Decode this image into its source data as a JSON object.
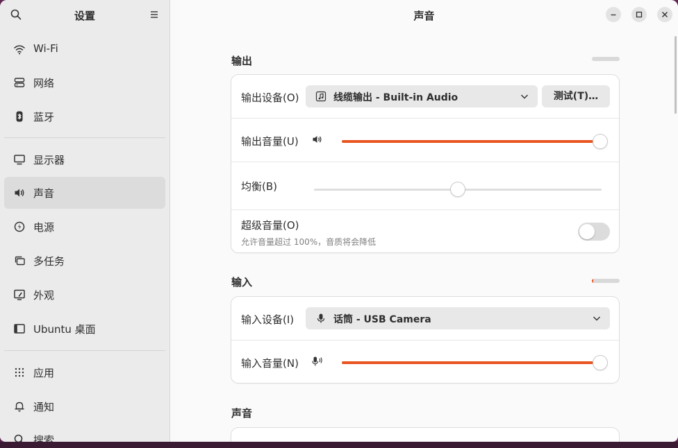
{
  "sidebar": {
    "title": "设置",
    "items": [
      {
        "label": "Wi-Fi",
        "icon": "wifi-icon"
      },
      {
        "label": "网络",
        "icon": "network-icon"
      },
      {
        "label": "蓝牙",
        "icon": "bluetooth-icon"
      },
      {
        "label": "显示器",
        "icon": "display-icon"
      },
      {
        "label": "声音",
        "icon": "speaker-icon"
      },
      {
        "label": "电源",
        "icon": "power-icon"
      },
      {
        "label": "多任务",
        "icon": "multitasking-icon"
      },
      {
        "label": "外观",
        "icon": "appearance-icon"
      },
      {
        "label": "Ubuntu 桌面",
        "icon": "ubuntu-desktop-icon"
      },
      {
        "label": "应用",
        "icon": "apps-grid-icon"
      },
      {
        "label": "通知",
        "icon": "bell-icon"
      },
      {
        "label": "搜索",
        "icon": "search-icon"
      }
    ],
    "active_index": 4
  },
  "main": {
    "title": "声音",
    "output": {
      "section_title": "输出",
      "level": 0.0,
      "device_label": "输出设备(O)",
      "device_value": "线缆输出 - Built-in Audio",
      "test_button": "测试(T)…",
      "volume_label": "输出音量(U)",
      "volume": 1.0,
      "balance_label": "均衡(B)",
      "balance": 0.5,
      "overamp_label": "超级音量(O)",
      "overamp_desc": "允许音量超过 100%，音质将会降低",
      "overamp_on": false
    },
    "input": {
      "section_title": "输入",
      "level": 0.05,
      "device_label": "输入设备(I)",
      "device_value": "话筒 - USB Camera",
      "volume_label": "输入音量(N)",
      "volume": 1.0
    },
    "sounds": {
      "section_title": "声音"
    }
  },
  "colors": {
    "accent": "#e95420",
    "sidebar_bg": "#ebebeb",
    "active_item_bg": "#dcdcdc"
  }
}
